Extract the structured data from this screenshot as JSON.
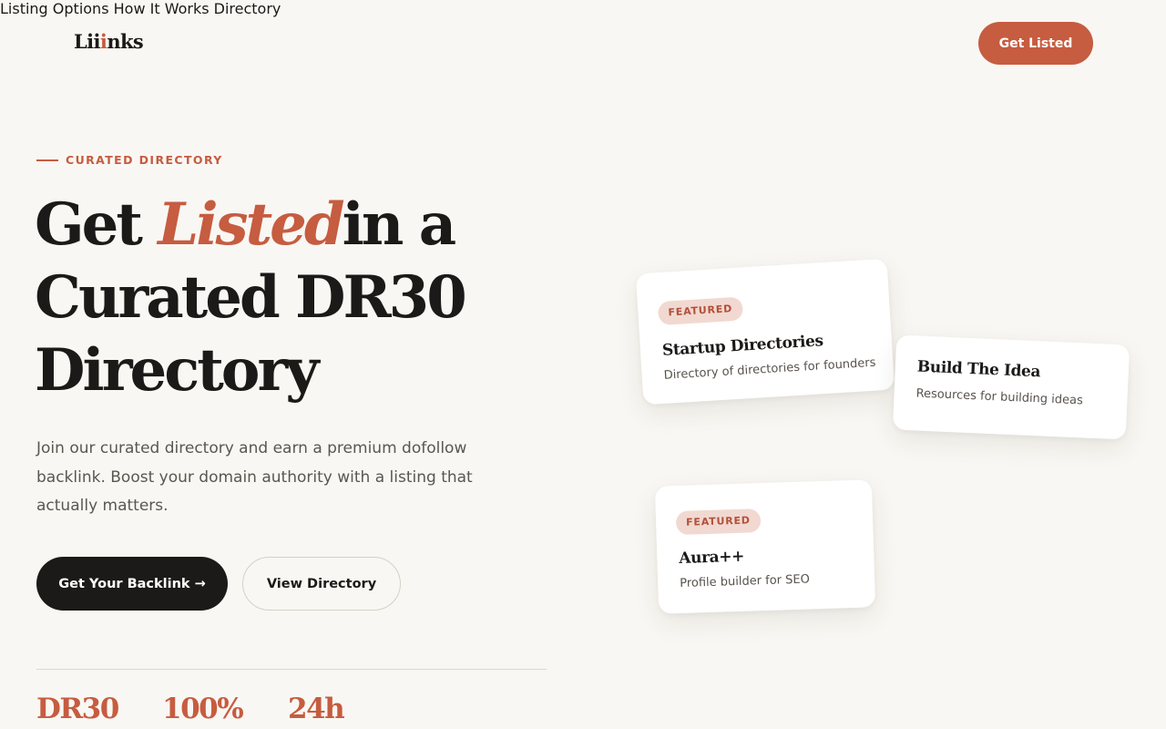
{
  "header": {
    "logo": {
      "part1": "Lii",
      "part2": "i",
      "part3": "nks"
    },
    "nav": [
      {
        "label": "Listing Options"
      },
      {
        "label": "How It Works"
      },
      {
        "label": "Directory"
      }
    ],
    "cta_label": "Get Listed"
  },
  "hero": {
    "eyebrow": "CURATED DIRECTORY",
    "headline": {
      "word1": "Get",
      "accent": "Listed",
      "word2": "in a",
      "line2": "Curated DR30",
      "line3": "Directory"
    },
    "lead": "Join our curated directory and earn a premium dofollow backlink. Boost your domain authority with a listing that actually matters.",
    "primary_button": "Get Your Backlink →",
    "secondary_button": "View Directory"
  },
  "stats": [
    "DR30",
    "100%",
    "24h"
  ],
  "cards": [
    {
      "badge": "FEATURED",
      "title": "Startup Directories",
      "desc": "Directory of directories for founders"
    },
    {
      "badge": "",
      "title": "Build The Idea",
      "desc": "Resources for building ideas"
    },
    {
      "badge": "FEATURED",
      "title": "Aura++",
      "desc": "Profile builder for SEO"
    }
  ],
  "colors": {
    "accent": "#c65c40",
    "dark": "#1c1a18",
    "background": "#f9f7f3",
    "badge_bg": "#f1d9d1"
  }
}
